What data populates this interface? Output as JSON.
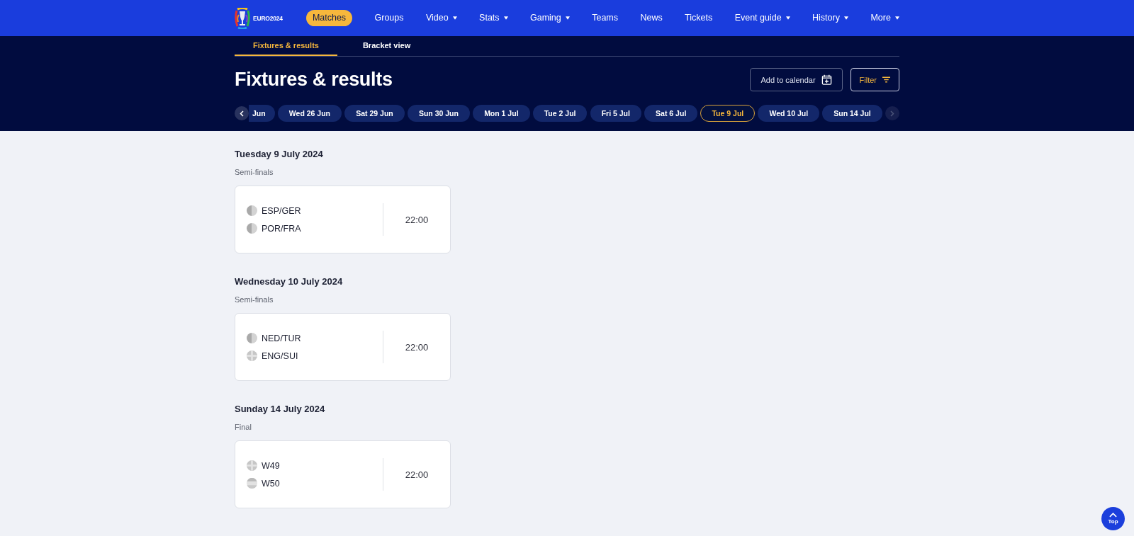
{
  "nav": {
    "logo_text": "EURO2024",
    "items": [
      {
        "label": "Matches",
        "selected": true,
        "has_menu": false
      },
      {
        "label": "Groups",
        "selected": false,
        "has_menu": false
      },
      {
        "label": "Video",
        "selected": false,
        "has_menu": true
      },
      {
        "label": "Stats",
        "selected": false,
        "has_menu": true
      },
      {
        "label": "Gaming",
        "selected": false,
        "has_menu": true
      },
      {
        "label": "Teams",
        "selected": false,
        "has_menu": false
      },
      {
        "label": "News",
        "selected": false,
        "has_menu": false
      },
      {
        "label": "Tickets",
        "selected": false,
        "has_menu": false
      },
      {
        "label": "Event guide",
        "selected": false,
        "has_menu": true
      },
      {
        "label": "History",
        "selected": false,
        "has_menu": true
      },
      {
        "label": "More",
        "selected": false,
        "has_menu": true
      }
    ]
  },
  "subtabs": [
    {
      "label": "Fixtures & results",
      "selected": true
    },
    {
      "label": "Bracket view",
      "selected": false
    }
  ],
  "page_title": "Fixtures & results",
  "actions": [
    {
      "label": "Add to calendar",
      "kind": "calendar"
    },
    {
      "label": "Filter",
      "kind": "filter"
    }
  ],
  "date_strip": {
    "prev_disabled": false,
    "next_disabled": true,
    "dates": [
      {
        "label": "Jun",
        "selected": false,
        "clipped": true
      },
      {
        "label": "Wed 26 Jun",
        "selected": false,
        "clipped": false
      },
      {
        "label": "Sat 29 Jun",
        "selected": false,
        "clipped": false
      },
      {
        "label": "Sun 30 Jun",
        "selected": false,
        "clipped": false
      },
      {
        "label": "Mon 1 Jul",
        "selected": false,
        "clipped": false
      },
      {
        "label": "Tue 2 Jul",
        "selected": false,
        "clipped": false
      },
      {
        "label": "Fri 5 Jul",
        "selected": false,
        "clipped": false
      },
      {
        "label": "Sat 6 Jul",
        "selected": false,
        "clipped": false
      },
      {
        "label": "Tue 9 Jul",
        "selected": true,
        "clipped": false
      },
      {
        "label": "Wed 10 Jul",
        "selected": false,
        "clipped": false
      },
      {
        "label": "Sun 14 Jul",
        "selected": false,
        "clipped": false
      }
    ]
  },
  "days": [
    {
      "date": "Tuesday 9 July 2024",
      "stage": "Semi-finals",
      "matches": [
        {
          "teams": [
            {
              "name": "ESP/GER",
              "kind": "split"
            },
            {
              "name": "POR/FRA",
              "kind": "split"
            }
          ],
          "time": "22:00"
        }
      ]
    },
    {
      "date": "Wednesday 10 July 2024",
      "stage": "Semi-finals",
      "matches": [
        {
          "teams": [
            {
              "name": "NED/TUR",
              "kind": "split"
            },
            {
              "name": "ENG/SUI",
              "kind": "cross"
            }
          ],
          "time": "22:00"
        }
      ]
    },
    {
      "date": "Sunday 14 July 2024",
      "stage": "Final",
      "matches": [
        {
          "teams": [
            {
              "name": "W49",
              "kind": "cross"
            },
            {
              "name": "W50",
              "kind": "band"
            }
          ],
          "time": "22:00"
        }
      ]
    }
  ],
  "top_button": {
    "label": "Top"
  }
}
